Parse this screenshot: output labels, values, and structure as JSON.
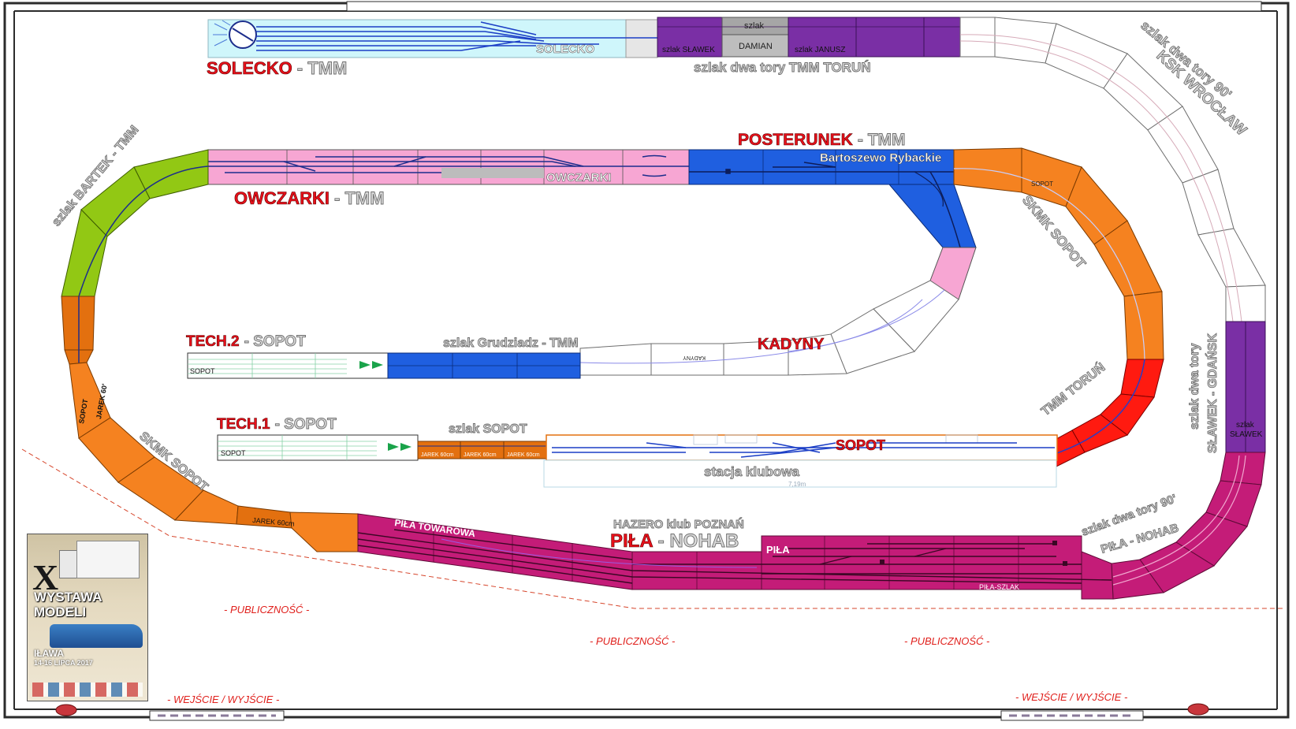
{
  "stations": {
    "solecko": {
      "title": "SOLECKO",
      "suffix": "TMM",
      "sign": "SOLECKO"
    },
    "owczarki": {
      "title": "OWCZARKI",
      "suffix": "TMM",
      "sign": "OWCZARKI"
    },
    "posterunek": {
      "title": "POSTERUNEK",
      "suffix": "TMM",
      "sign": "Bartoszewo Rybackie"
    },
    "kadyny": {
      "title": "KADYNY",
      "sign": "KADYNY"
    },
    "tech2": {
      "title": "TECH.2",
      "suffix": "SOPOT",
      "sign": "SOPOT"
    },
    "tech1": {
      "title": "TECH.1",
      "suffix": "SOPOT",
      "sign": "SOPOT"
    },
    "sopot": {
      "title": "SOPOT",
      "subtitle": "stacja klubowa",
      "length": "7,19m"
    },
    "pila": {
      "title": "PIŁA",
      "suffix": "NOHAB",
      "club": "HAZERO klub POZNAŃ",
      "sign": "PIŁA",
      "towarowa": "PIŁA TOWAROWA",
      "szlak": "PIŁA-SZLAK"
    }
  },
  "modules": {
    "top_szlak": {
      "slawek": "szlak SŁAWEK",
      "szlak": "szlak",
      "damian": "DAMIAN",
      "janusz": "szlak JANUSZ"
    },
    "szlak_dwa_tory_tmm": "szlak dwa tory   TMM TORUŃ",
    "ksk": {
      "line1": "szlak dwa tory 90'",
      "line2": "KSK WROCŁAW"
    },
    "bartek": "szlak BARTEK - TMM",
    "skmk_right": "SKMK SOPOT",
    "skmk_left": "SKMK SOPOT",
    "grudziadz": "szlak Grudziadz - TMM",
    "szlak_sopot": "szlak SOPOT",
    "jarek": [
      "JAREK 60cm",
      "JAREK 60cm",
      "JAREK 60cm"
    ],
    "jarek_left": "JAREK 60cm",
    "jarek_corner": {
      "line1": "SOPOT",
      "line2": "JAREK 60'"
    },
    "tmm_torun": "TMM TORUŃ",
    "slawek_gdansk": {
      "line1": "szlak dwa tory",
      "line2": "SŁAWEK - GDAŃSK",
      "box1": "szlak",
      "box2": "SŁAWEK"
    },
    "pila_nohab_curve": {
      "line1": "szlak dwa tory 90'",
      "line2": "PIŁA - NOHAB"
    },
    "sopot_small": "SOPOT"
  },
  "room": {
    "public": [
      "- PUBLICZNOŚĆ -",
      "- PUBLICZNOŚĆ -",
      "- PUBLICZNOŚĆ -"
    ],
    "entrance": [
      "- WEJŚCIE / WYJŚCIE -",
      "- WEJŚCIE / WYJŚCIE -"
    ]
  },
  "poster": {
    "number": "X",
    "line1": "WYSTAWA",
    "line2": "MODELI",
    "city": "IŁAWA",
    "dates": "14-16 LIPCA 2017"
  },
  "colors": {
    "blue": "#1f5fe0",
    "pink": "#f7a6d3",
    "purple": "#7a2fa5",
    "orange": "#f58220",
    "green": "#92c814",
    "red": "#ff1a10",
    "magenta": "#c41c78",
    "light_cyan": "#cff6fb",
    "track": "#1c2d8c"
  }
}
